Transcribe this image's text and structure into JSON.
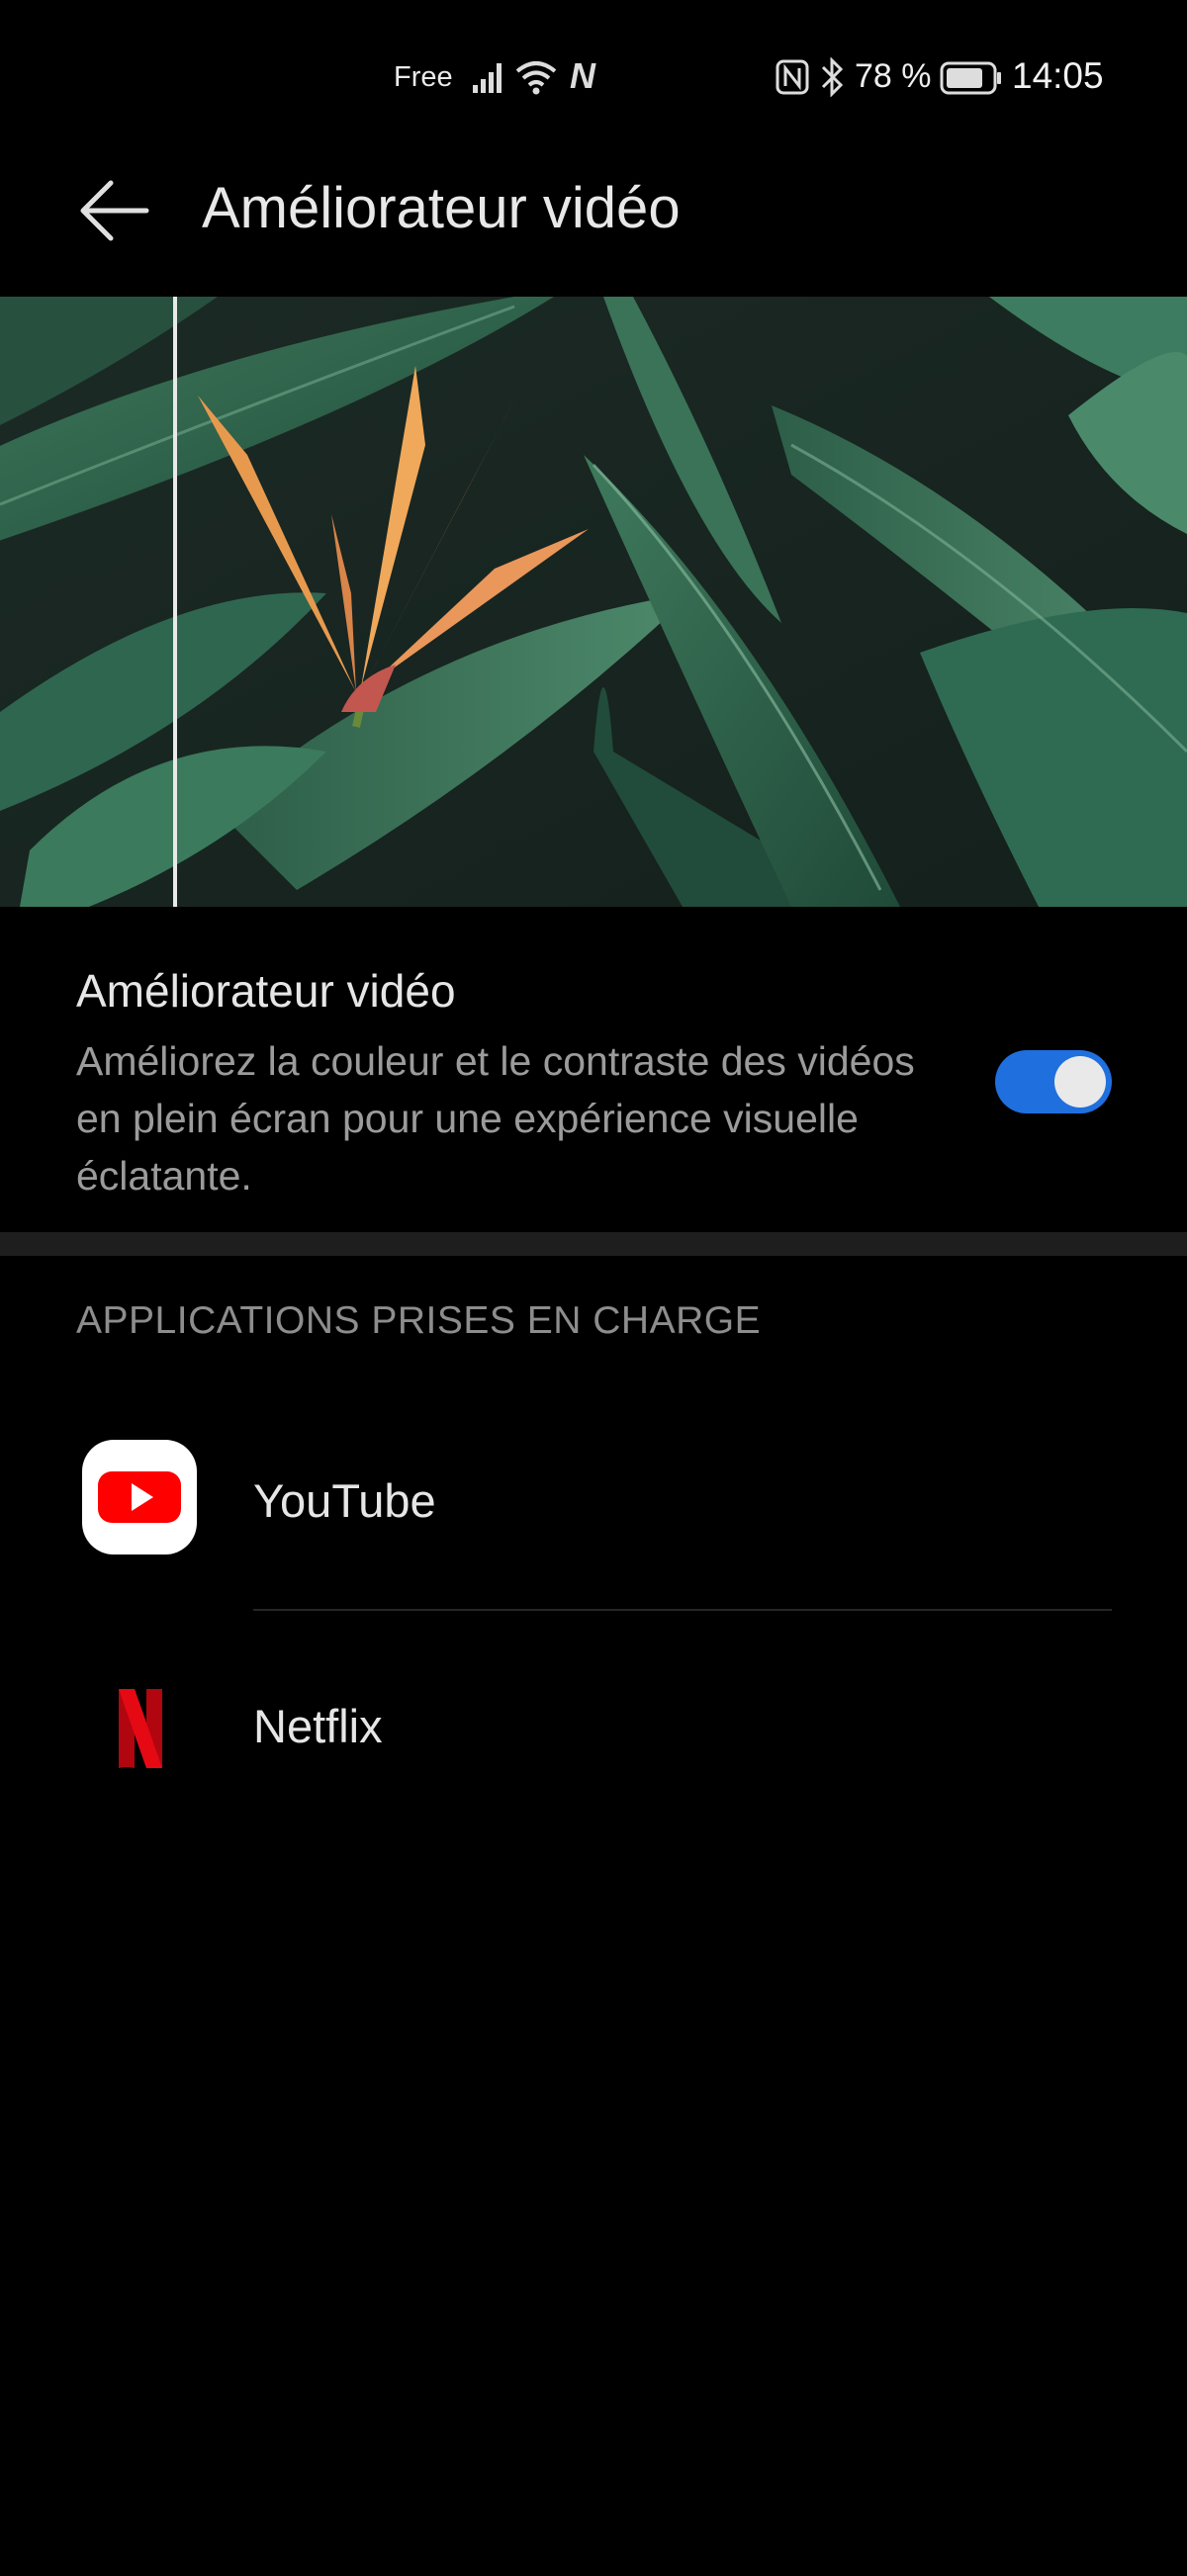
{
  "status_bar": {
    "carrier": "Free",
    "battery": "78 %",
    "time": "14:05"
  },
  "header": {
    "title": "Améliorateur vidéo"
  },
  "setting": {
    "title": "Améliorateur vidéo",
    "description": "Améliorez la couleur et le contraste des vidéos en plein écran pour une expérience visuelle éclatante.",
    "enabled": true
  },
  "section": {
    "title": "APPLICATIONS PRISES EN CHARGE"
  },
  "apps": [
    {
      "name": "YouTube",
      "icon": "youtube-icon"
    },
    {
      "name": "Netflix",
      "icon": "netflix-icon"
    }
  ],
  "colors": {
    "accent": "#1f6fde",
    "youtube_red": "#ff0000",
    "netflix_red": "#e50914"
  }
}
